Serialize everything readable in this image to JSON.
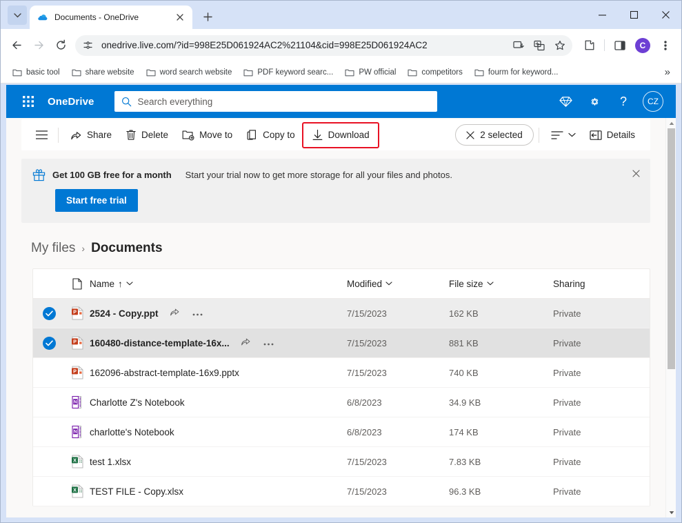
{
  "browser": {
    "tab": {
      "title": "Documents - OneDrive",
      "favicon": "onedrive-cloud-icon",
      "close": "×"
    },
    "new_tab_label": "+",
    "window_controls": {
      "minimize": "—",
      "maximize": "□",
      "close": "✕"
    },
    "nav": {
      "back": "←",
      "forward": "→",
      "reload": "⟳"
    },
    "url": "onedrive.live.com/?id=998E25D061924AC2%21104&cid=998E25D061924AC2",
    "profile_initial": "C",
    "bookmarks": [
      "basic tool",
      "share website",
      "word search website",
      "PDF keyword searc...",
      "PW official",
      "competitors",
      "fourm for keyword..."
    ],
    "bookmarks_overflow": "»"
  },
  "onedrive": {
    "brand": "OneDrive",
    "search_placeholder": "Search everything",
    "avatar_initials": "CZ",
    "header_icons": [
      "diamond-premium-icon",
      "settings-gear-icon",
      "help-question-icon"
    ]
  },
  "commandbar": {
    "share_label": "Share",
    "delete_label": "Delete",
    "move_to_label": "Move to",
    "copy_to_label": "Copy to",
    "download_label": "Download",
    "download_highlight_color": "#e81123",
    "selected_label": "2 selected",
    "details_label": "Details"
  },
  "promo": {
    "title": "Get 100 GB free for a month",
    "subtitle": "Start your trial now to get more storage for all your files and photos.",
    "button_label": "Start free trial",
    "accent_color": "#0078d4"
  },
  "breadcrumb": {
    "root": "My files",
    "separator": "›",
    "current": "Documents"
  },
  "table": {
    "columns": {
      "name": "Name",
      "name_sort": "↑",
      "modified": "Modified",
      "file_size": "File size",
      "sharing": "Sharing"
    },
    "rows": [
      {
        "name": "2524 - Copy.ppt",
        "type": "powerpoint",
        "modified": "7/15/2023",
        "size": "162 KB",
        "sharing": "Private",
        "selected": true
      },
      {
        "name": "160480-distance-template-16x...",
        "type": "powerpoint",
        "modified": "7/15/2023",
        "size": "881 KB",
        "sharing": "Private",
        "selected": true
      },
      {
        "name": "162096-abstract-template-16x9.pptx",
        "type": "powerpoint",
        "modified": "7/15/2023",
        "size": "740 KB",
        "sharing": "Private",
        "selected": false
      },
      {
        "name": "Charlotte Z's Notebook",
        "type": "onenote",
        "modified": "6/8/2023",
        "size": "34.9 KB",
        "sharing": "Private",
        "selected": false
      },
      {
        "name": "charlotte's Notebook",
        "type": "onenote",
        "modified": "6/8/2023",
        "size": "174 KB",
        "sharing": "Private",
        "selected": false
      },
      {
        "name": "test 1.xlsx",
        "type": "excel",
        "modified": "7/15/2023",
        "size": "7.83 KB",
        "sharing": "Private",
        "selected": false
      },
      {
        "name": "TEST FILE - Copy.xlsx",
        "type": "excel",
        "modified": "7/15/2023",
        "size": "96.3 KB",
        "sharing": "Private",
        "selected": false
      }
    ]
  }
}
